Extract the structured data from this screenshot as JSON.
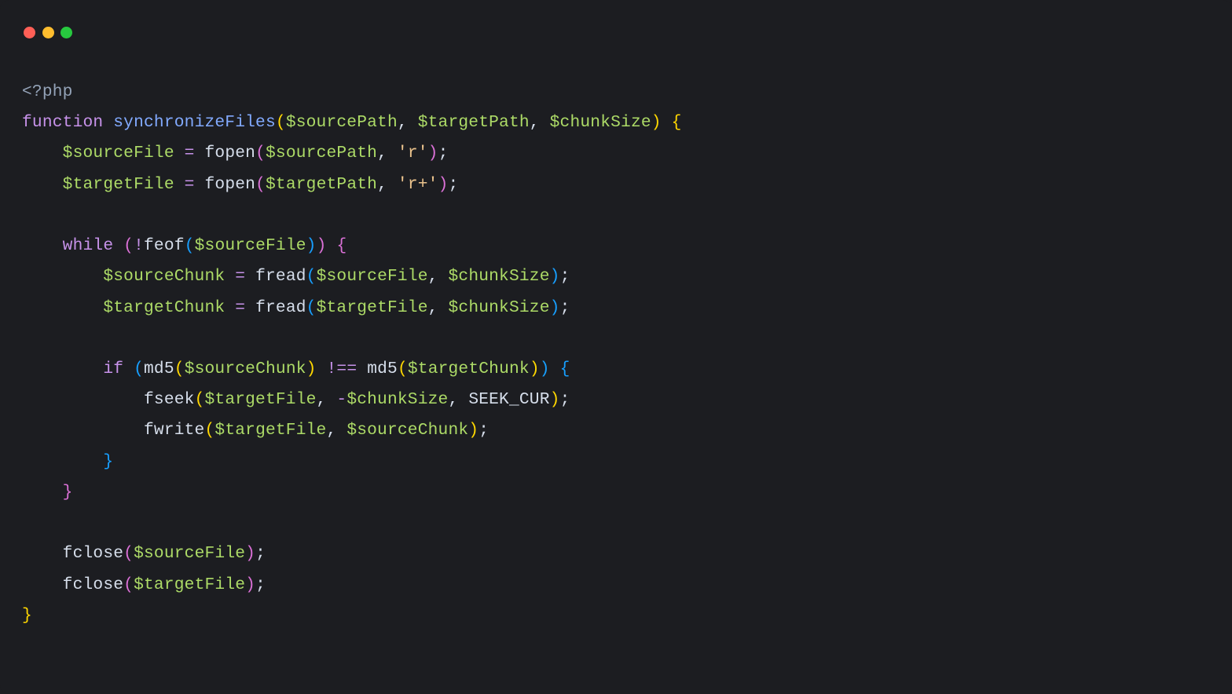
{
  "traffic_lights": {
    "red": "#ff5f56",
    "yellow": "#ffbd2e",
    "green": "#27c93f"
  },
  "code": {
    "language": "php",
    "tokens": {
      "open_tag": "<?php",
      "kw_function": "function",
      "fn_name": "synchronizeFiles",
      "var_sourcePath": "$sourcePath",
      "var_targetPath": "$targetPath",
      "var_chunkSize": "$chunkSize",
      "var_sourceFile": "$sourceFile",
      "var_targetFile": "$targetFile",
      "var_sourceChunk": "$sourceChunk",
      "var_targetChunk": "$targetChunk",
      "fn_fopen": "fopen",
      "fn_feof": "feof",
      "fn_fread": "fread",
      "fn_md5": "md5",
      "fn_fseek": "fseek",
      "fn_fwrite": "fwrite",
      "fn_fclose": "fclose",
      "kw_while": "while",
      "kw_if": "if",
      "str_r": "'r'",
      "str_rplus": "'r+'",
      "const_seekcur": "SEEK_CUR",
      "op_assign": "=",
      "op_neq": "!==",
      "op_not": "!",
      "op_neg": "-",
      "comma": ",",
      "semi": ";",
      "lbrace": "{",
      "rbrace": "}",
      "lparen": "(",
      "rparen": ")"
    }
  }
}
